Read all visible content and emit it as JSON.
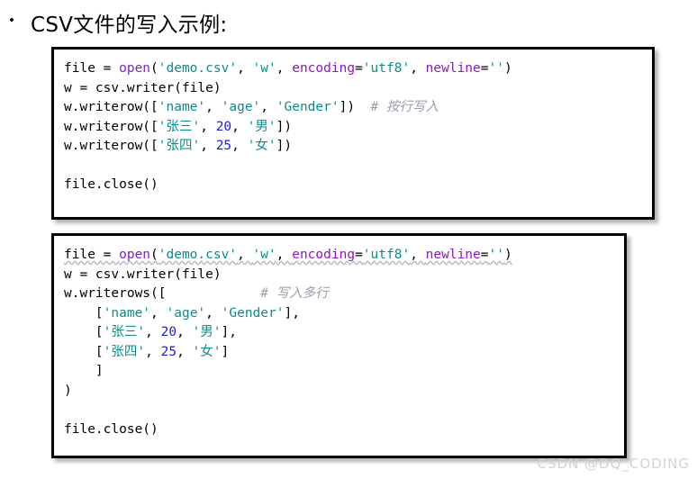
{
  "slide": {
    "bullet_glyph": "•",
    "title": "CSV文件的写入示例:"
  },
  "watermark": "CSDN @DQ_CODING",
  "colors": {
    "function": "#7a26c4",
    "string": "#0f8a8a",
    "keyword_arg": "#9016c4",
    "number": "#1a1ae6",
    "comment": "#9b9bab",
    "plain": "#000000",
    "block_border": "#000000",
    "squiggle": "#b9b9c4"
  },
  "code_block_1": {
    "lines": [
      {
        "tokens": [
          {
            "text": "file = ",
            "cls": "t-plain"
          },
          {
            "text": "open",
            "cls": "t-fn"
          },
          {
            "text": "(",
            "cls": "t-plain"
          },
          {
            "text": "'demo.csv'",
            "cls": "t-str"
          },
          {
            "text": ", ",
            "cls": "t-plain"
          },
          {
            "text": "'w'",
            "cls": "t-str"
          },
          {
            "text": ", ",
            "cls": "t-plain"
          },
          {
            "text": "encoding",
            "cls": "t-kwarg"
          },
          {
            "text": "=",
            "cls": "t-plain"
          },
          {
            "text": "'utf8'",
            "cls": "t-str"
          },
          {
            "text": ", ",
            "cls": "t-plain"
          },
          {
            "text": "newline",
            "cls": "t-kwarg"
          },
          {
            "text": "=",
            "cls": "t-plain"
          },
          {
            "text": "''",
            "cls": "t-str"
          },
          {
            "text": ")",
            "cls": "t-plain"
          }
        ]
      },
      {
        "tokens": [
          {
            "text": "w = csv.writer(file)",
            "cls": "t-plain"
          }
        ]
      },
      {
        "tokens": [
          {
            "text": "w.writerow([",
            "cls": "t-plain"
          },
          {
            "text": "'name'",
            "cls": "t-str"
          },
          {
            "text": ", ",
            "cls": "t-plain"
          },
          {
            "text": "'age'",
            "cls": "t-str"
          },
          {
            "text": ", ",
            "cls": "t-plain"
          },
          {
            "text": "'Gender'",
            "cls": "t-str"
          },
          {
            "text": "])  ",
            "cls": "t-plain"
          },
          {
            "text": "# 按行写入",
            "cls": "t-cmt"
          }
        ]
      },
      {
        "tokens": [
          {
            "text": "w.writerow([",
            "cls": "t-plain"
          },
          {
            "text": "'张三'",
            "cls": "t-str"
          },
          {
            "text": ", ",
            "cls": "t-plain"
          },
          {
            "text": "20",
            "cls": "t-num"
          },
          {
            "text": ", ",
            "cls": "t-plain"
          },
          {
            "text": "'男'",
            "cls": "t-str"
          },
          {
            "text": "])",
            "cls": "t-plain"
          }
        ]
      },
      {
        "tokens": [
          {
            "text": "w.writerow([",
            "cls": "t-plain"
          },
          {
            "text": "'张四'",
            "cls": "t-str"
          },
          {
            "text": ", ",
            "cls": "t-plain"
          },
          {
            "text": "25",
            "cls": "t-num"
          },
          {
            "text": ", ",
            "cls": "t-plain"
          },
          {
            "text": "'女'",
            "cls": "t-str"
          },
          {
            "text": "])",
            "cls": "t-plain"
          }
        ]
      },
      {
        "tokens": []
      },
      {
        "tokens": [
          {
            "text": "file.close()",
            "cls": "t-plain"
          }
        ]
      }
    ]
  },
  "code_block_2": {
    "lines": [
      {
        "squiggle": true,
        "tokens": [
          {
            "text": "file = ",
            "cls": "t-plain"
          },
          {
            "text": "open",
            "cls": "t-fn"
          },
          {
            "text": "(",
            "cls": "t-plain"
          },
          {
            "text": "'demo.csv'",
            "cls": "t-str"
          },
          {
            "text": ", ",
            "cls": "t-plain"
          },
          {
            "text": "'w'",
            "cls": "t-str"
          },
          {
            "text": ", ",
            "cls": "t-plain"
          },
          {
            "text": "encoding",
            "cls": "t-kwarg"
          },
          {
            "text": "=",
            "cls": "t-plain"
          },
          {
            "text": "'utf8'",
            "cls": "t-str"
          },
          {
            "text": ", ",
            "cls": "t-plain"
          },
          {
            "text": "newline",
            "cls": "t-kwarg"
          },
          {
            "text": "=",
            "cls": "t-plain"
          },
          {
            "text": "''",
            "cls": "t-str"
          },
          {
            "text": ")",
            "cls": "t-plain"
          }
        ]
      },
      {
        "tokens": [
          {
            "text": "w = csv.writer(file)",
            "cls": "t-plain"
          }
        ]
      },
      {
        "tokens": [
          {
            "text": "w.writerows([            ",
            "cls": "t-plain"
          },
          {
            "text": "# 写入多行",
            "cls": "t-cmt"
          }
        ]
      },
      {
        "tokens": [
          {
            "text": "    [",
            "cls": "t-plain"
          },
          {
            "text": "'name'",
            "cls": "t-str"
          },
          {
            "text": ", ",
            "cls": "t-plain"
          },
          {
            "text": "'age'",
            "cls": "t-str"
          },
          {
            "text": ", ",
            "cls": "t-plain"
          },
          {
            "text": "'Gender'",
            "cls": "t-str"
          },
          {
            "text": "],",
            "cls": "t-plain"
          }
        ]
      },
      {
        "tokens": [
          {
            "text": "    [",
            "cls": "t-plain"
          },
          {
            "text": "'张三'",
            "cls": "t-str"
          },
          {
            "text": ", ",
            "cls": "t-plain"
          },
          {
            "text": "20",
            "cls": "t-num"
          },
          {
            "text": ", ",
            "cls": "t-plain"
          },
          {
            "text": "'男'",
            "cls": "t-str"
          },
          {
            "text": "],",
            "cls": "t-plain"
          }
        ]
      },
      {
        "tokens": [
          {
            "text": "    [",
            "cls": "t-plain"
          },
          {
            "text": "'张四'",
            "cls": "t-str"
          },
          {
            "text": ", ",
            "cls": "t-plain"
          },
          {
            "text": "25",
            "cls": "t-num"
          },
          {
            "text": ", ",
            "cls": "t-plain"
          },
          {
            "text": "'女'",
            "cls": "t-str"
          },
          {
            "text": "]",
            "cls": "t-plain"
          }
        ]
      },
      {
        "tokens": [
          {
            "text": "    ]",
            "cls": "t-plain"
          }
        ]
      },
      {
        "tokens": [
          {
            "text": ")",
            "cls": "t-plain"
          }
        ]
      },
      {
        "tokens": []
      },
      {
        "tokens": [
          {
            "text": "file.close()",
            "cls": "t-plain"
          }
        ]
      }
    ]
  }
}
